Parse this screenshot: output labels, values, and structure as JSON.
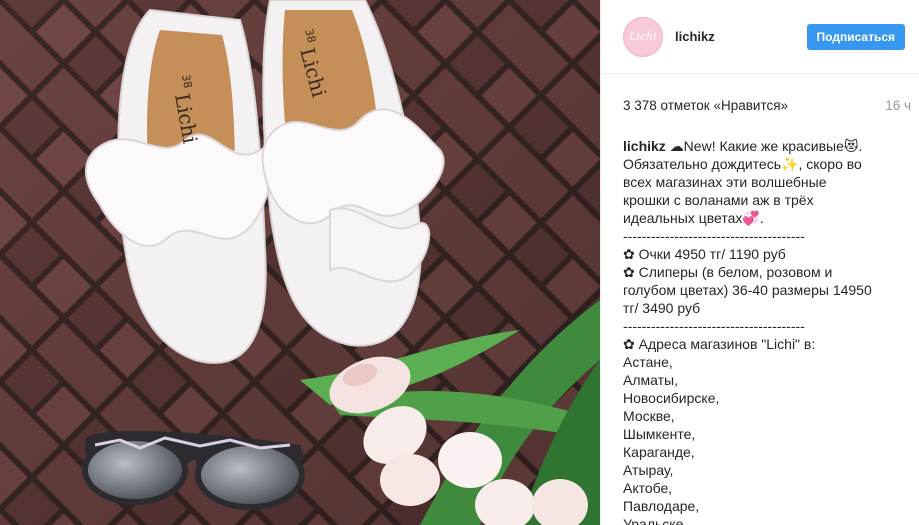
{
  "post": {
    "username": "lichikz",
    "avatar_text": "Lichi",
    "follow_label": "Подписаться",
    "likes": "3 378 отметок «Нравится»",
    "time": "16 ч",
    "caption_author": "lichikz",
    "caption_text": " ☁New! Какие же красивые😻.\nОбязательно дождитесь✨, скоро во\nвсех магазинах эти волшебные\nкрошки с воланами аж в трёх\nидеальных цветах💞.\n---------------------------------------\n✿ Очки 4950 тг/ 1190 руб\n✿ Слиперы (в белом, розовом и\nголубом цветах) 36-40 размеры 14950\nтг/ 3490 руб\n---------------------------------------\n✿ Адреса магазинов \"Lichi\" в:\nАстане,\nАлматы,\nНовосибирске,\nМоскве,\nШымкенте,\nКараганде,\nАтырау,\nАктобе,\nПавлодаре,\nУральске"
  },
  "photo": {
    "insole_brand": "Lichi",
    "insole_size": "38",
    "colors": {
      "brick": "#6b4340",
      "grout": "#3a2826",
      "shoe": "#f4f1f2",
      "tulip": "#f5e3e1",
      "leaf": "#3f8a3c",
      "accent": "#3897f0"
    }
  }
}
